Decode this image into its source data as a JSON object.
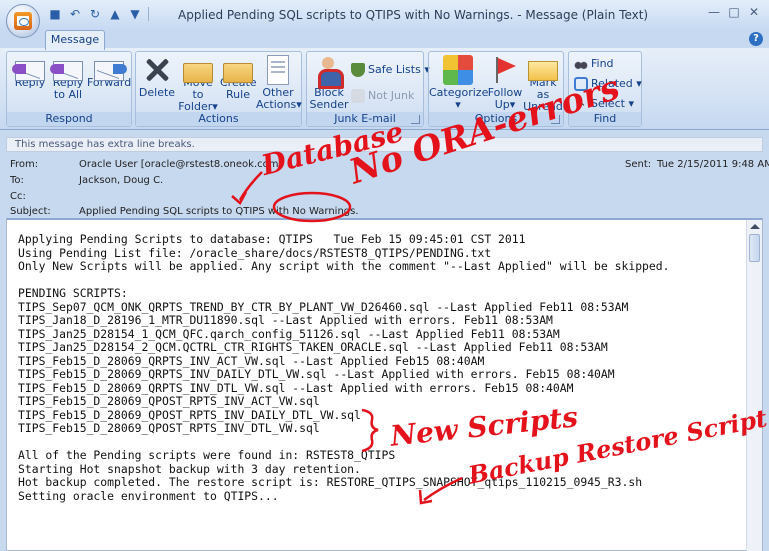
{
  "window": {
    "title": "Applied Pending SQL scripts to QTIPS with No Warnings. - Message (Plain Text)"
  },
  "ribbon": {
    "tab_message": "Message",
    "groups": {
      "respond": {
        "label": "Respond",
        "reply": "Reply",
        "reply_all_1": "Reply",
        "reply_all_2": "to All",
        "forward": "Forward"
      },
      "actions": {
        "label": "Actions",
        "delete": "Delete",
        "move_1": "Move to",
        "move_2": "Folder",
        "create_1": "Create",
        "create_2": "Rule",
        "other_1": "Other",
        "other_2": "Actions"
      },
      "junk": {
        "label": "Junk E-mail",
        "block_1": "Block",
        "block_2": "Sender",
        "safe_lists": "Safe Lists",
        "not_junk": "Not Junk"
      },
      "options": {
        "label": "Options",
        "categorize": "Categorize",
        "follow_1": "Follow",
        "follow_2": "Up",
        "mark_1": "Mark as",
        "mark_2": "Unread"
      },
      "find": {
        "label": "Find",
        "find": "Find",
        "related": "Related",
        "select": "Select"
      }
    }
  },
  "infobar": "This message has extra line breaks.",
  "header": {
    "from_label": "From:",
    "from_value": "Oracle User [oracle@rstest8.oneok.com]",
    "sent_label": "Sent:",
    "sent_value": "Tue 2/15/2011 9:48 AM",
    "to_label": "To:",
    "to_value": "Jackson, Doug C.",
    "cc_label": "Cc:",
    "cc_value": "",
    "subject_label": "Subject:",
    "subject_value": "Applied Pending SQL scripts to QTIPS with No Warnings."
  },
  "body_lines": [
    "Applying Pending Scripts to database: QTIPS   Tue Feb 15 09:45:01 CST 2011",
    "Using Pending List file: /oracle_share/docs/RSTEST8_QTIPS/PENDING.txt",
    "Only New Scripts will be applied. Any script with the comment \"--Last Applied\" will be skipped.",
    "",
    "PENDING SCRIPTS:",
    "TIPS_Sep07_QCM_ONK_QRPTS_TREND_BY_CTR_BY_PLANT_VW_D26460.sql --Last Applied Feb11 08:53AM",
    "TIPS_Jan18_D_28196_1_MTR_DU11890.sql --Last Applied with errors. Feb11 08:53AM",
    "TIPS_Jan25_D28154_1_QCM_QFC.qarch_config_51126.sql --Last Applied Feb11 08:53AM",
    "TIPS_Jan25_D28154_2_QCM.QCTRL_CTR_RIGHTS_TAKEN_ORACLE.sql --Last Applied Feb11 08:53AM",
    "TIPS_Feb15_D_28069_QRPTS_INV_ACT_VW.sql --Last Applied Feb15 08:40AM",
    "TIPS_Feb15_D_28069_QRPTS_INV_DAILY_DTL_VW.sql --Last Applied with errors. Feb15 08:40AM",
    "TIPS_Feb15_D_28069_QRPTS_INV_DTL_VW.sql --Last Applied with errors. Feb15 08:40AM",
    "TIPS_Feb15_D_28069_QPOST_RPTS_INV_ACT_VW.sql",
    "TIPS_Feb15_D_28069_QPOST_RPTS_INV_DAILY_DTL_VW.sql",
    "TIPS_Feb15_D_28069_QPOST_RPTS_INV_DTL_VW.sql",
    "",
    "All of the Pending scripts were found in: RSTEST8_QTIPS",
    "Starting Hot snapshot backup with 3 day retention.",
    "Hot backup completed. The restore script is: RESTORE_QTIPS_SNAPSHOT_qtips_110215_0945_R3.sh",
    "Setting oracle environment to QTIPS..."
  ],
  "annotations": {
    "database": "Database",
    "no_ora_errors": "No ORA-errors",
    "new_scripts": "New Scripts",
    "backup_restore": "Backup Restore Script"
  },
  "colors": {
    "annotation": "#e3121b",
    "ribbon_text": "#15428b",
    "accent": "#c6d9f1"
  }
}
